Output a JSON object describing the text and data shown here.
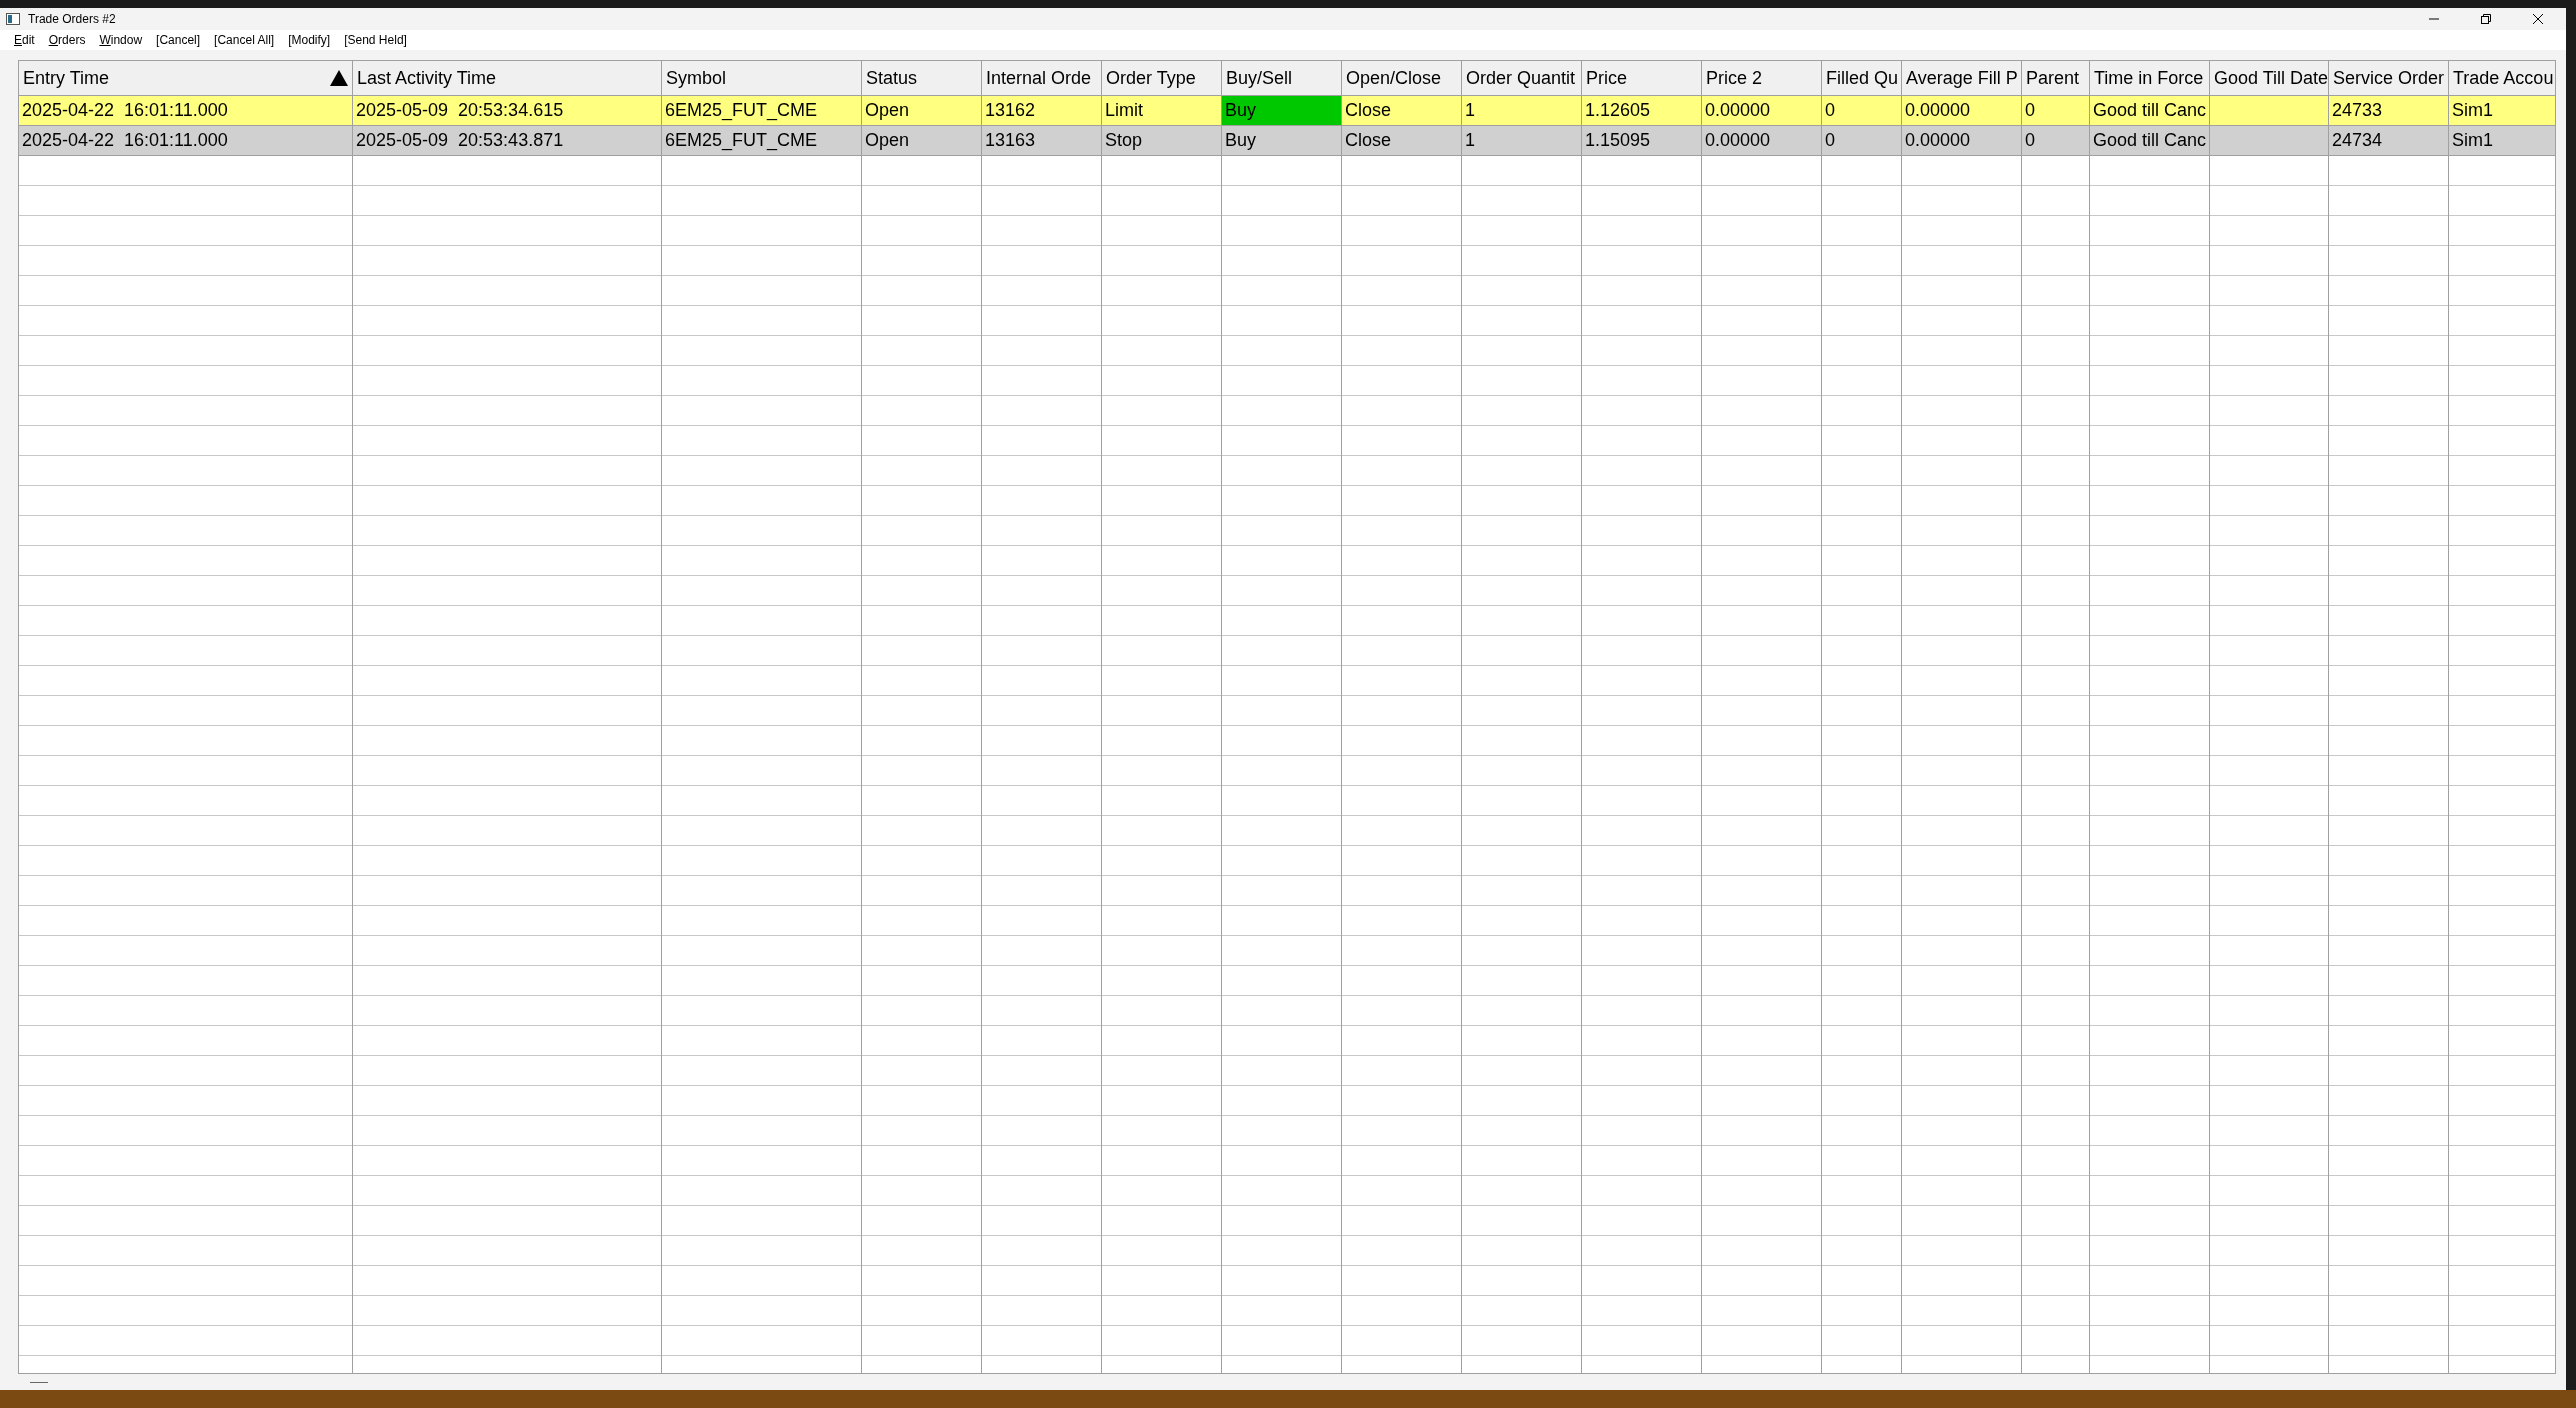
{
  "window": {
    "title": "Trade Orders #2"
  },
  "menu": [
    {
      "label": "Edit",
      "kind": "menu"
    },
    {
      "label": "Orders",
      "kind": "menu"
    },
    {
      "label": "Window",
      "kind": "menu"
    },
    {
      "label": "[Cancel]",
      "kind": "command"
    },
    {
      "label": "[Cancel All]",
      "kind": "command"
    },
    {
      "label": "[Modify]",
      "kind": "command"
    },
    {
      "label": "[Send Held]",
      "kind": "command"
    }
  ],
  "table": {
    "columns": [
      {
        "label": "Entry Time",
        "sorted": true
      },
      {
        "label": "Last Activity Time",
        "sorted": false
      },
      {
        "label": "Symbol",
        "sorted": false
      },
      {
        "label": "Status",
        "sorted": false
      },
      {
        "label": "Internal Orde",
        "sorted": false
      },
      {
        "label": "Order Type",
        "sorted": false
      },
      {
        "label": "Buy/Sell",
        "sorted": false
      },
      {
        "label": "Open/Close",
        "sorted": false
      },
      {
        "label": "Order Quantit",
        "sorted": false
      },
      {
        "label": "Price",
        "sorted": false
      },
      {
        "label": "Price 2",
        "sorted": false
      },
      {
        "label": "Filled Qu",
        "sorted": false
      },
      {
        "label": "Average Fill P",
        "sorted": false
      },
      {
        "label": "Parent",
        "sorted": false
      },
      {
        "label": "Time in Force",
        "sorted": false
      },
      {
        "label": "Good Till Date",
        "sorted": false
      },
      {
        "label": "Service Order",
        "sorted": false
      },
      {
        "label": "Trade Accou",
        "sorted": false
      }
    ],
    "rows": [
      {
        "selected": true,
        "cells": [
          {
            "text": "2025-04-22  16:01:11.000",
            "selected": false
          },
          {
            "text": "2025-05-09  20:53:34.615",
            "selected": false
          },
          {
            "text": "6EM25_FUT_CME",
            "selected": false
          },
          {
            "text": "Open",
            "selected": false
          },
          {
            "text": "13162",
            "selected": false
          },
          {
            "text": "Limit",
            "selected": false
          },
          {
            "text": "Buy",
            "selected": true
          },
          {
            "text": "Close",
            "selected": false
          },
          {
            "text": "1",
            "selected": false
          },
          {
            "text": "1.12605",
            "selected": false
          },
          {
            "text": "0.00000",
            "selected": false
          },
          {
            "text": "0",
            "selected": false
          },
          {
            "text": "0.00000",
            "selected": false
          },
          {
            "text": "0",
            "selected": false
          },
          {
            "text": "Good till Canc",
            "selected": false
          },
          {
            "text": "",
            "selected": false
          },
          {
            "text": "24733",
            "selected": false
          },
          {
            "text": "Sim1",
            "selected": false
          }
        ]
      },
      {
        "selected": false,
        "cells": [
          {
            "text": "2025-04-22  16:01:11.000",
            "selected": false
          },
          {
            "text": "2025-05-09  20:53:43.871",
            "selected": false
          },
          {
            "text": "6EM25_FUT_CME",
            "selected": false
          },
          {
            "text": "Open",
            "selected": false
          },
          {
            "text": "13163",
            "selected": false
          },
          {
            "text": "Stop",
            "selected": false
          },
          {
            "text": "Buy",
            "selected": false
          },
          {
            "text": "Close",
            "selected": false
          },
          {
            "text": "1",
            "selected": false
          },
          {
            "text": "1.15095",
            "selected": false
          },
          {
            "text": "0.00000",
            "selected": false
          },
          {
            "text": "0",
            "selected": false
          },
          {
            "text": "0.00000",
            "selected": false
          },
          {
            "text": "0",
            "selected": false
          },
          {
            "text": "Good till Canc",
            "selected": false
          },
          {
            "text": "",
            "selected": false
          },
          {
            "text": "24734",
            "selected": false
          },
          {
            "text": "Sim1",
            "selected": false
          }
        ]
      }
    ]
  }
}
